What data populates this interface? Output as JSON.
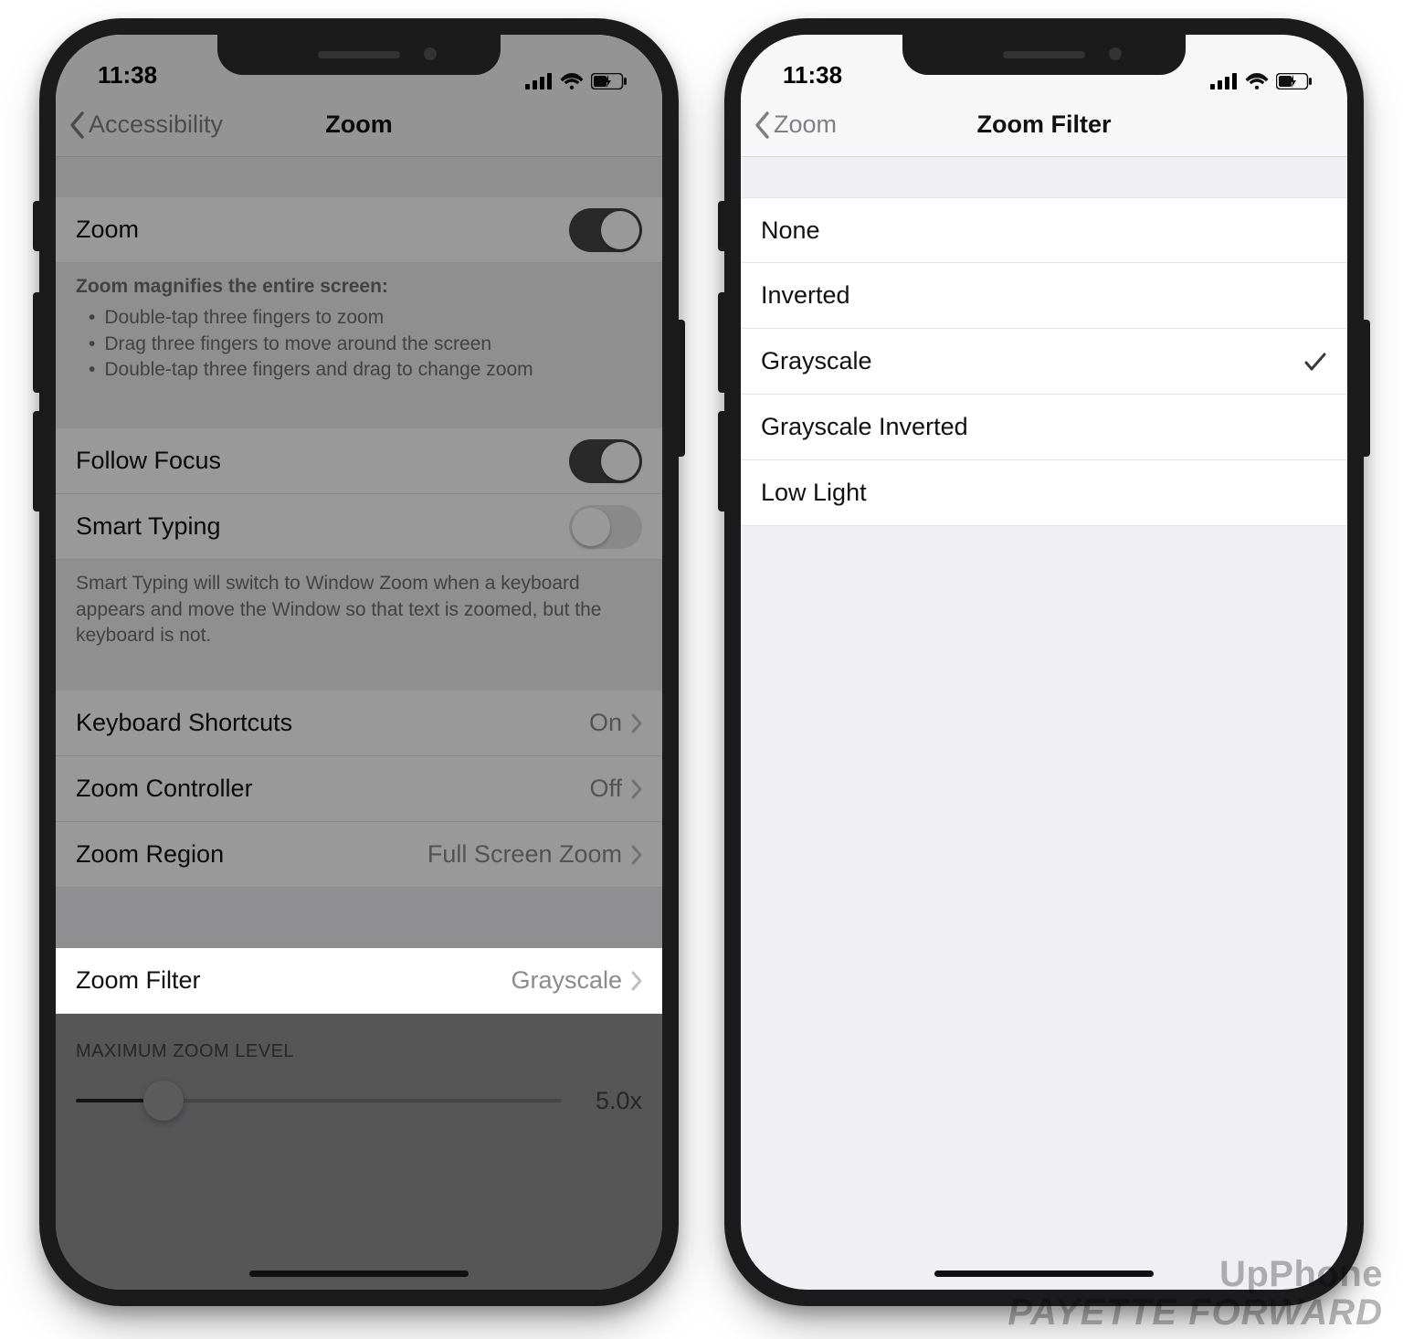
{
  "status_time": "11:38",
  "watermark": {
    "line1": "UpPhone",
    "line2": "PAYETTE FORWARD"
  },
  "left": {
    "nav": {
      "back": "Accessibility",
      "title": "Zoom"
    },
    "zoom_toggle": {
      "label": "Zoom",
      "on": true
    },
    "zoom_help": {
      "header": "Zoom magnifies the entire screen:",
      "bullets": [
        "Double-tap three fingers to zoom",
        "Drag three fingers to move around the screen",
        "Double-tap three fingers and drag to change zoom"
      ]
    },
    "follow_focus": {
      "label": "Follow Focus",
      "on": true
    },
    "smart_typing": {
      "label": "Smart Typing",
      "on": false
    },
    "smart_typing_note": "Smart Typing will switch to Window Zoom when a keyboard appears and move the Window so that text is zoomed, but the keyboard is not.",
    "rows": {
      "keyboard_shortcuts": {
        "label": "Keyboard Shortcuts",
        "value": "On"
      },
      "zoom_controller": {
        "label": "Zoom Controller",
        "value": "Off"
      },
      "zoom_region": {
        "label": "Zoom Region",
        "value": "Full Screen Zoom"
      },
      "zoom_filter": {
        "label": "Zoom Filter",
        "value": "Grayscale"
      }
    },
    "max_zoom": {
      "header": "MAXIMUM ZOOM LEVEL",
      "value": "5.0x",
      "percent": 18
    }
  },
  "right": {
    "nav": {
      "back": "Zoom",
      "title": "Zoom Filter"
    },
    "options": [
      "None",
      "Inverted",
      "Grayscale",
      "Grayscale Inverted",
      "Low Light"
    ],
    "selected": "Grayscale"
  }
}
